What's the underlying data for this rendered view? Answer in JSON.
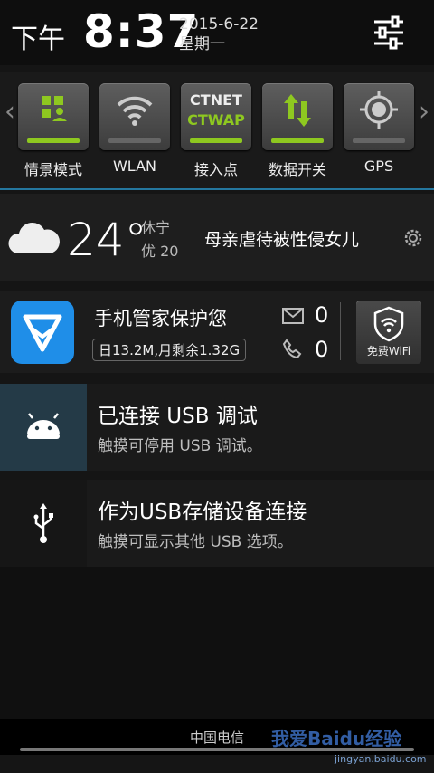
{
  "header": {
    "ampm": "下午",
    "time": "8:37",
    "date": "2015-6-22",
    "weekday": "星期一",
    "settings_icon": "sliders-icon"
  },
  "toggles": [
    {
      "label": "情景模式",
      "icon": "profile-mode-icon",
      "on": true
    },
    {
      "label": "WLAN",
      "icon": "wifi-icon",
      "on": false
    },
    {
      "label": "接入点",
      "icon": "apn-icon",
      "line1": "CTNET",
      "line2": "CTWAP",
      "on": true
    },
    {
      "label": "数据开关",
      "icon": "data-toggle-icon",
      "on": true
    },
    {
      "label": "GPS",
      "icon": "gps-icon",
      "on": false
    }
  ],
  "weather": {
    "temp": "24°",
    "city": "休宁",
    "aqi": "优 20",
    "headline": "母亲虐待被性侵女儿"
  },
  "tencent": {
    "title": "手机管家保护您",
    "usage": "日13.2M,月剩余1.32G",
    "mail_count": "0",
    "call_count": "0",
    "wifi_label": "免费WiFi"
  },
  "notifications": [
    {
      "title": "已连接 USB 调试",
      "subtitle": "触摸可停用 USB 调试。",
      "icon": "android-debug-icon"
    },
    {
      "title": "作为USB存储设备连接",
      "subtitle": "触摸可显示其他 USB 选项。",
      "icon": "usb-icon"
    }
  ],
  "footer": {
    "carrier": "中国电信",
    "watermark": "我爱Baidu经验",
    "watermark_url": "jingyan.baidu.com"
  },
  "colors": {
    "accent_green": "#8ec820",
    "accent_blue": "#2aa0d8",
    "tencent_blue": "#1f8ee8"
  }
}
